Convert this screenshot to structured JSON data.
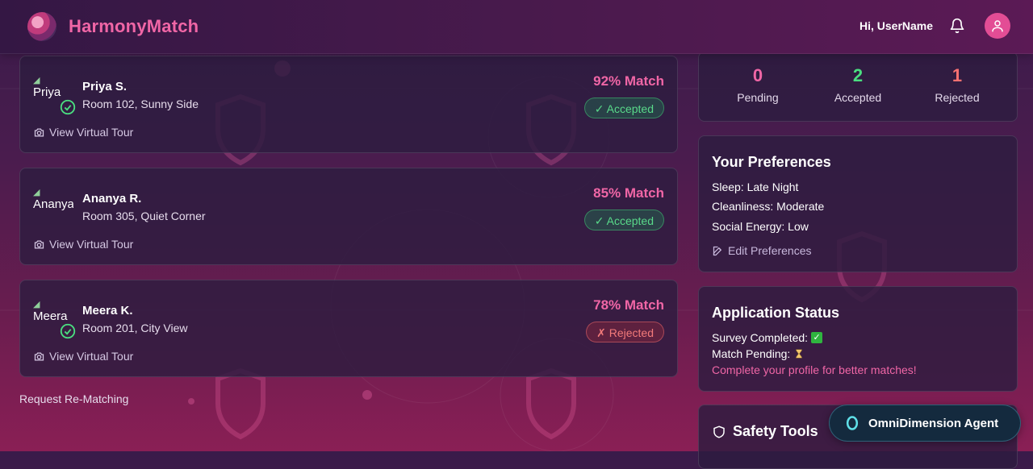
{
  "header": {
    "brand": "HarmonyMatch",
    "greeting": "Hi, UserName"
  },
  "matches": [
    {
      "photo_alt": "Priya",
      "name": "Priya S.",
      "room": "Room 102, Sunny Side",
      "match": "92% Match",
      "status": "✓ Accepted",
      "status_type": "accepted",
      "verified": true,
      "tour_label": "View Virtual Tour"
    },
    {
      "photo_alt": "Ananya",
      "name": "Ananya R.",
      "room": "Room 305, Quiet Corner",
      "match": "85% Match",
      "status": "✓ Accepted",
      "status_type": "accepted",
      "verified": false,
      "tour_label": "View Virtual Tour"
    },
    {
      "photo_alt": "Meera",
      "name": "Meera K.",
      "room": "Room 201, City View",
      "match": "78% Match",
      "status": "✗ Rejected",
      "status_type": "rejected",
      "verified": true,
      "tour_label": "View Virtual Tour"
    }
  ],
  "rematch_label": "Request Re-Matching",
  "stats": {
    "pending": {
      "value": "0",
      "label": "Pending",
      "color": "#f066a6"
    },
    "accepted": {
      "value": "2",
      "label": "Accepted",
      "color": "#4ade80"
    },
    "rejected": {
      "value": "1",
      "label": "Rejected",
      "color": "#f87171"
    }
  },
  "preferences": {
    "title": "Your Preferences",
    "sleep": "Sleep: Late Night",
    "cleanliness": "Cleanliness: Moderate",
    "social": "Social Energy: Low",
    "edit_label": "Edit Preferences"
  },
  "application": {
    "title": "Application Status",
    "survey": "Survey Completed:",
    "pending": "Match Pending:",
    "hint": "Complete your profile for better matches!"
  },
  "safety": {
    "title": "Safety Tools"
  },
  "agent": {
    "label": "OmniDimension Agent"
  },
  "colors": {
    "accent": "#f066a6",
    "accepted": "#4ade80",
    "rejected": "#f87171"
  }
}
